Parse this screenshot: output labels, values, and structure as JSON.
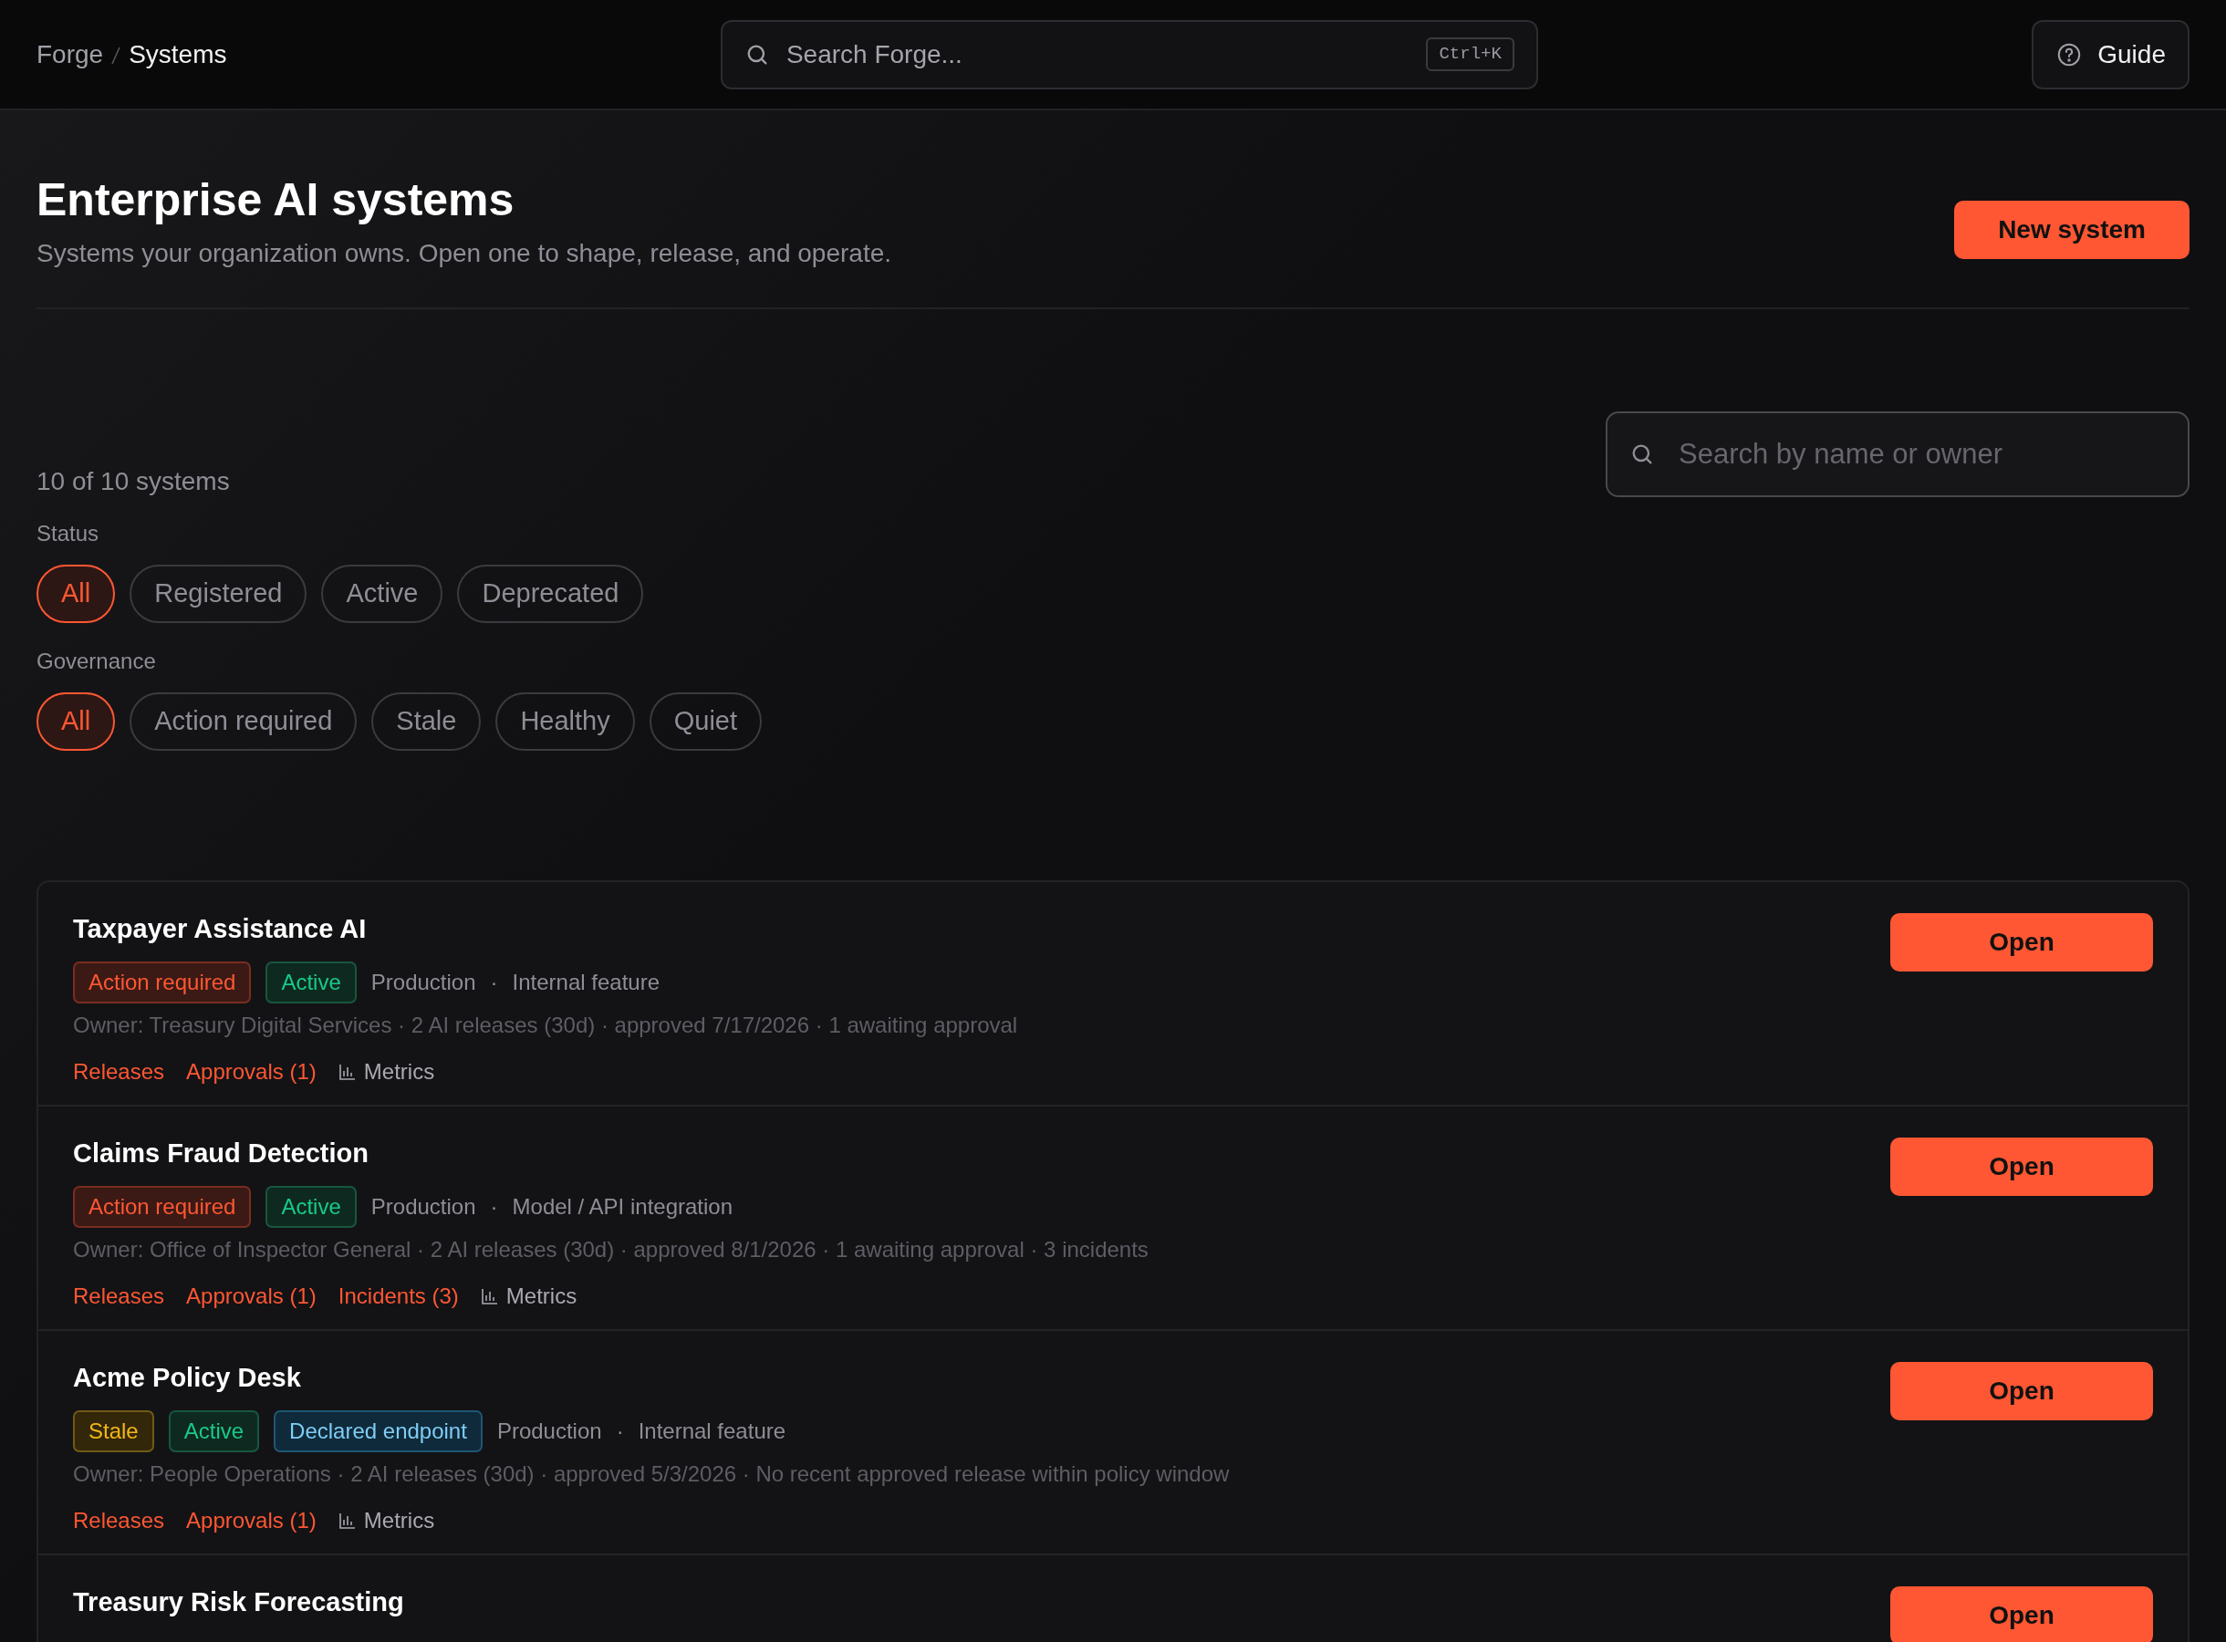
{
  "breadcrumb": [
    {
      "label": "Forge",
      "current": false
    },
    {
      "label": "Systems",
      "current": true
    }
  ],
  "search": {
    "placeholder": "Search Forge...",
    "shortcut": "Ctrl+K"
  },
  "guide_button": "Guide",
  "page": {
    "title": "Enterprise AI systems",
    "subtitle": "Systems your organization owns. Open one to shape, release, and operate.",
    "primary_button": "New system"
  },
  "filter_search": {
    "placeholder": "Search by name or owner"
  },
  "count": "10 of 10 systems",
  "filters": [
    {
      "label": "Status",
      "options": [
        {
          "label": "All",
          "selected": true
        },
        {
          "label": "Registered",
          "selected": false
        },
        {
          "label": "Active",
          "selected": false
        },
        {
          "label": "Deprecated",
          "selected": false
        }
      ]
    },
    {
      "label": "Governance",
      "options": [
        {
          "label": "All",
          "selected": true
        },
        {
          "label": "Action required",
          "selected": false
        },
        {
          "label": "Stale",
          "selected": false
        },
        {
          "label": "Healthy",
          "selected": false
        },
        {
          "label": "Quiet",
          "selected": false
        }
      ]
    }
  ],
  "systems": [
    {
      "name": "Taxpayer Assistance AI",
      "tags": [
        {
          "label": "Action required",
          "kind": "danger"
        },
        {
          "label": "Active",
          "kind": "success"
        }
      ],
      "details": [
        "Production",
        "·",
        "Internal feature"
      ],
      "meta": "Owner: Treasury Digital Services · 2 AI releases (30d) · approved 7/17/2026 · 1 awaiting approval",
      "links": [
        {
          "label": "Releases",
          "kind": "alert"
        },
        {
          "label": "Approvals (1)",
          "kind": "alert"
        },
        {
          "label": "Metrics",
          "kind": "metrics"
        }
      ],
      "action": "Open"
    },
    {
      "name": "Claims Fraud Detection",
      "tags": [
        {
          "label": "Action required",
          "kind": "danger"
        },
        {
          "label": "Active",
          "kind": "success"
        }
      ],
      "details": [
        "Production",
        "·",
        "Model / API integration"
      ],
      "meta": "Owner: Office of Inspector General · 2 AI releases (30d) · approved 8/1/2026 · 1 awaiting approval · 3 incidents",
      "links": [
        {
          "label": "Releases",
          "kind": "alert"
        },
        {
          "label": "Approvals (1)",
          "kind": "alert"
        },
        {
          "label": "Incidents (3)",
          "kind": "alert"
        },
        {
          "label": "Metrics",
          "kind": "metrics"
        }
      ],
      "action": "Open"
    },
    {
      "name": "Acme Policy Desk",
      "tags": [
        {
          "label": "Stale",
          "kind": "warning"
        },
        {
          "label": "Active",
          "kind": "success"
        },
        {
          "label": "Declared endpoint",
          "kind": "info"
        }
      ],
      "details": [
        "Production",
        "·",
        "Internal feature"
      ],
      "meta": "Owner: People Operations · 2 AI releases (30d) · approved 5/3/2026 · No recent approved release within policy window",
      "links": [
        {
          "label": "Releases",
          "kind": "alert"
        },
        {
          "label": "Approvals (1)",
          "kind": "alert"
        },
        {
          "label": "Metrics",
          "kind": "metrics"
        }
      ],
      "action": "Open"
    },
    {
      "name": "Treasury Risk Forecasting",
      "action": "Open"
    }
  ]
}
